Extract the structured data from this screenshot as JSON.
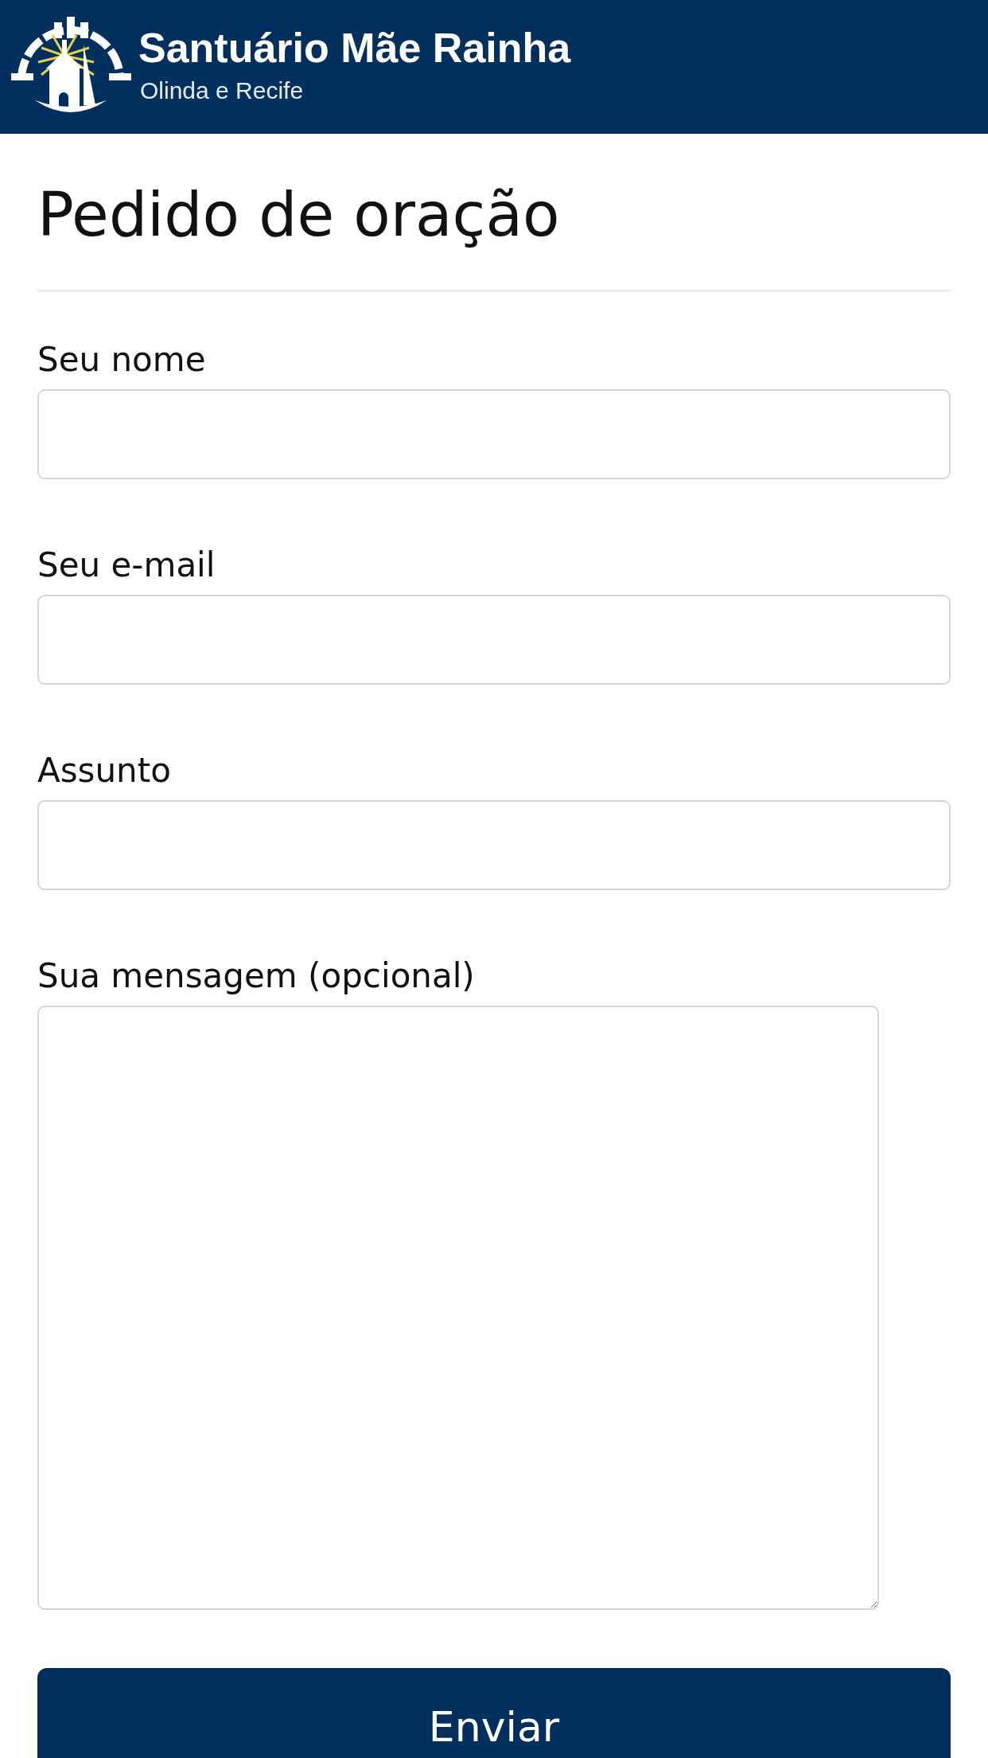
{
  "header": {
    "logo": {
      "title": "Santuário Mãe Rainha",
      "subtitle": "Olinda e Recife"
    }
  },
  "page_title": "Pedido de oração",
  "form": {
    "fields": [
      {
        "kind": "text",
        "label": "Seu nome"
      },
      {
        "kind": "text",
        "label": "Seu e-mail"
      },
      {
        "kind": "text",
        "label": "Assunto"
      },
      {
        "kind": "textarea",
        "label": "Sua mensagem (opcional)"
      }
    ],
    "submit": "Enviar"
  }
}
